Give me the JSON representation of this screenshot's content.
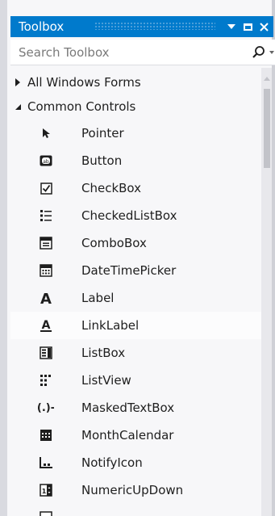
{
  "toolbox": {
    "title": "Toolbox",
    "search_placeholder": "Search Toolbox",
    "categories": [
      {
        "label": "All Windows Forms",
        "expanded": false
      },
      {
        "label": "Common Controls",
        "expanded": true
      }
    ],
    "items": [
      {
        "label": "Pointer",
        "icon": "pointer-icon"
      },
      {
        "label": "Button",
        "icon": "button-icon"
      },
      {
        "label": "CheckBox",
        "icon": "checkbox-icon"
      },
      {
        "label": "CheckedListBox",
        "icon": "checkedlistbox-icon"
      },
      {
        "label": "ComboBox",
        "icon": "combobox-icon"
      },
      {
        "label": "DateTimePicker",
        "icon": "datetimepicker-icon"
      },
      {
        "label": "Label",
        "icon": "label-icon"
      },
      {
        "label": "LinkLabel",
        "icon": "linklabel-icon"
      },
      {
        "label": "ListBox",
        "icon": "listbox-icon"
      },
      {
        "label": "ListView",
        "icon": "listview-icon"
      },
      {
        "label": "MaskedTextBox",
        "icon": "maskedtextbox-icon"
      },
      {
        "label": "MonthCalendar",
        "icon": "monthcalendar-icon"
      },
      {
        "label": "NotifyIcon",
        "icon": "notifyicon-icon"
      },
      {
        "label": "NumericUpDown",
        "icon": "numericupdown-icon"
      }
    ],
    "colors": {
      "titlebar": "#007acc",
      "background": "#f7f7f9",
      "text": "#1e1e1e"
    }
  }
}
